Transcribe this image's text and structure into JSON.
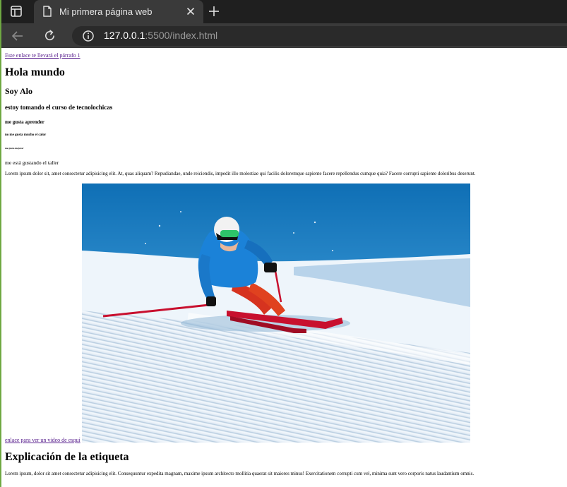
{
  "browser": {
    "tab_title": "Mi primera página web",
    "url_host": "127.0.0.1",
    "url_rest": ":5500/index.html"
  },
  "page": {
    "top_link": "Este enlace te llevará el párrafo 1",
    "h1": "Hola mundo",
    "h2": "Soy Alo",
    "h3": "estoy tomando el curso de tecnolochicas",
    "h4": "me gusta aprender",
    "h5": "no me gusta mucho el calor",
    "h6": "me gusta mejorar",
    "p_short": "me está gustando el taller",
    "p_lorem": "Lorem ipsum dolor sit, amet consectetur adipisicing elit. At, quas aliquam? Repudiandae, unde reiciendis, impedit illo molestiae qui facilis doloremque sapiente facere repellendus cumque quia? Facere corrupti sapiente doloribus deserunt.",
    "video_link": "enlace para ver un video de esquí",
    "section_title": "Explicación de la etiqueta",
    "p_lorem2": "Lorem ipsum, dolor sit amet consectetur adipisicing elit. Consequuntur expedita magnam, maxime ipsum architecto mollitia quaerat sit maiores minus! Exercitationem corrupti cum vel, minima sunt vero corporis natus laudantium omnis."
  },
  "icons": {
    "tab_actions": "sidebar-icon",
    "favicon": "document-icon",
    "close": "close-icon",
    "new_tab": "plus-icon",
    "back": "back-arrow-icon",
    "reload": "reload-icon",
    "site_info": "info-icon"
  }
}
